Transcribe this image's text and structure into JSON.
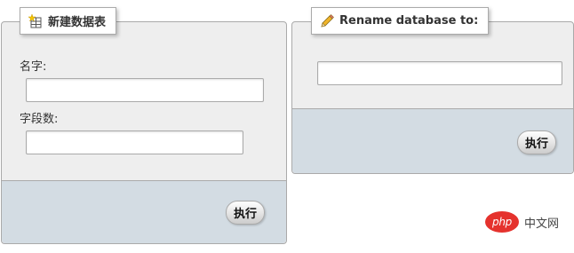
{
  "create_table": {
    "legend_title": "新建数据表",
    "legend_icon": "new-table-icon",
    "name_label": "名字:",
    "name_value": "",
    "columns_label": "字段数:",
    "columns_value": "",
    "go_label": "执行"
  },
  "rename_database": {
    "legend_title": "Rename database to:",
    "legend_icon": "pencil-icon",
    "new_name_value": "",
    "go_label": "执行"
  },
  "watermark": {
    "logo_text": "php",
    "site_name": "中文网",
    "logo_color": "#e5322d"
  },
  "colors": {
    "panel_background": "#eeeeee",
    "footer_background": "#d3dce3",
    "border": "#aaaaaa"
  }
}
